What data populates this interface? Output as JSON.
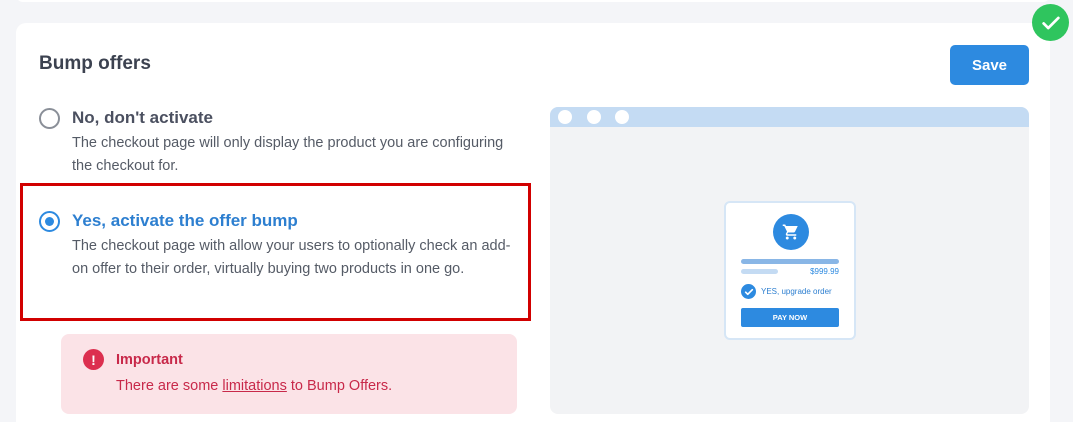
{
  "section": {
    "title": "Bump offers",
    "save_label": "Save"
  },
  "options": [
    {
      "label": "No, don't activate",
      "description": "The checkout page will only display the product you are configuring the checkout for.",
      "selected": false
    },
    {
      "label": "Yes, activate the offer bump",
      "description": "The checkout page with allow your users to optionally check an add-on offer to their order, virtually buying two products in one go.",
      "selected": true
    }
  ],
  "notice": {
    "icon": "exclamation-icon",
    "title": "Important",
    "text_before": "There are some ",
    "link_text": "limitations",
    "text_after": " to Bump Offers."
  },
  "preview": {
    "price": "$999.99",
    "checkbox_label": "YES, upgrade order",
    "pay_label": "PAY NOW"
  },
  "colors": {
    "accent": "#2d8ae0",
    "success": "#2fc55e",
    "highlight_border": "#d10000",
    "notice_bg": "#fbe3e7",
    "notice_text": "#c8294a"
  }
}
